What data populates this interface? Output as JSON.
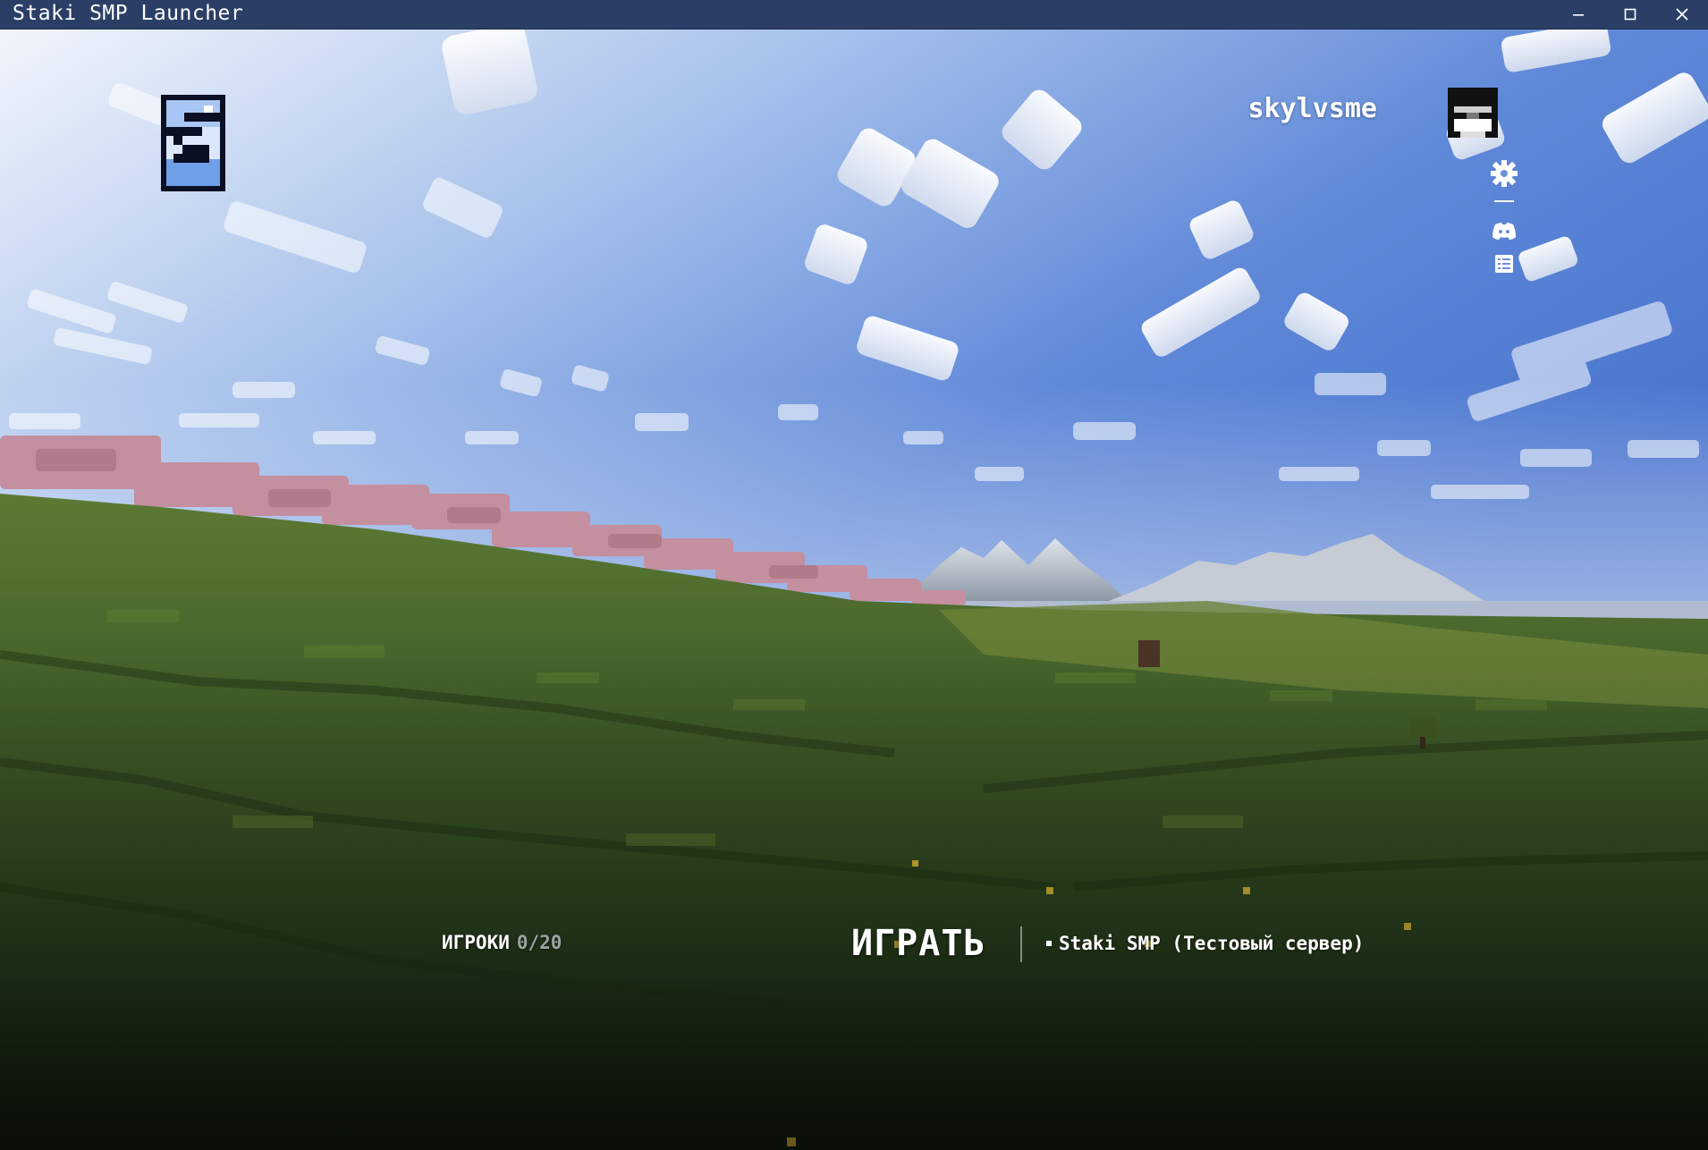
{
  "window": {
    "title": "Staki SMP Launcher"
  },
  "header": {
    "username": "skylvsme"
  },
  "sidebar": {
    "icons": [
      "gear-icon",
      "discord-icon",
      "list-icon"
    ]
  },
  "bottom": {
    "players_label": "ИГРОКИ",
    "players_count": "0/20",
    "play_label": "ИГРАТЬ",
    "server_name": "Staki SMP (Тестовый сервер)"
  },
  "colors": {
    "titlebar": "#2b3f66",
    "text": "#ffffff",
    "muted": "#9aa3a0",
    "logo_blue": "#6f9fe6"
  }
}
